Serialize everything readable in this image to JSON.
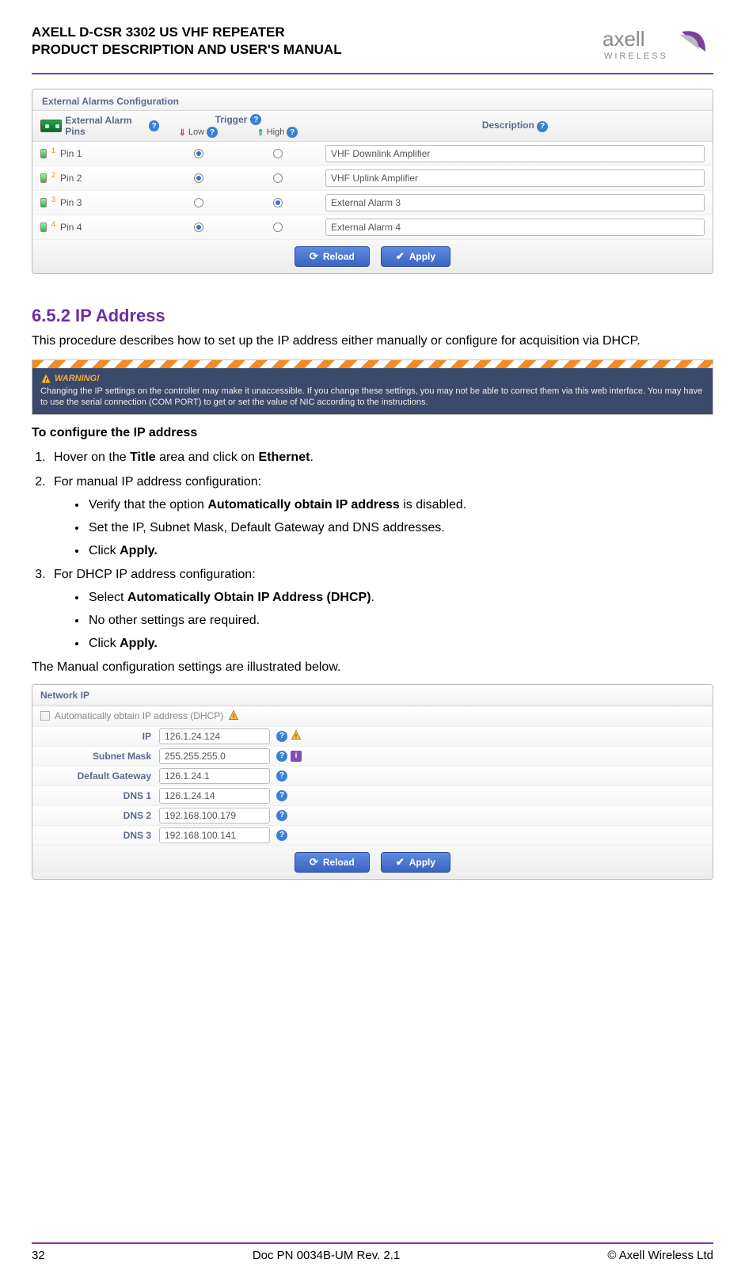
{
  "header": {
    "title_line1": "AXELL D-CSR 3302 US VHF REPEATER",
    "title_line2": "PRODUCT DESCRIPTION AND USER'S MANUAL",
    "logo_text_top": "axell",
    "logo_text_bottom": "WIRELESS"
  },
  "alarms_panel": {
    "title": "External Alarms Configuration",
    "headers": {
      "pins": "External Alarm Pins",
      "trigger": "Trigger",
      "trigger_low": "Low",
      "trigger_high": "High",
      "description": "Description"
    },
    "rows": [
      {
        "sup": "1",
        "pin": "Pin 1",
        "low": true,
        "high": false,
        "desc": "VHF Downlink Amplifier"
      },
      {
        "sup": "2",
        "pin": "Pin 2",
        "low": true,
        "high": false,
        "desc": "VHF Uplink Amplifier"
      },
      {
        "sup": "3",
        "pin": "Pin 3",
        "low": false,
        "high": true,
        "desc": "External Alarm 3"
      },
      {
        "sup": "4",
        "pin": "Pin 4",
        "low": true,
        "high": false,
        "desc": "External Alarm 4"
      }
    ],
    "buttons": {
      "reload": "Reload",
      "apply": "Apply"
    }
  },
  "section": {
    "heading": "6.5.2 IP Address",
    "intro": "This procedure describes how to set up the IP address either manually or configure for acquisition via DHCP.",
    "warning_label": "WARNING!",
    "warning_text": "Changing the IP settings on the controller may make it unaccessible. If you change these settings, you may not be able to correct them via this web interface. You may have to use the serial connection (COM PORT) to get or set the value of NIC according to the instructions.",
    "subhead": "To configure the IP address",
    "step1_pre": "Hover on the ",
    "step1_b1": "Title",
    "step1_mid": " area and click on ",
    "step1_b2": "Ethernet",
    "step1_post": ".",
    "step2": "For manual IP address configuration:",
    "s2b1_pre": "Verify that the option ",
    "s2b1_b": "Automatically obtain IP address",
    "s2b1_post": " is disabled.",
    "s2b2": "Set the IP, Subnet Mask, Default Gateway and DNS addresses.",
    "s2b3_pre": "Click ",
    "s2b3_b": "Apply.",
    "step3": "For DHCP IP address configuration:",
    "s3b1_pre": "Select ",
    "s3b1_b": "Automatically Obtain IP Address (DHCP)",
    "s3b1_post": ".",
    "s3b2": "No other settings are required.",
    "s3b3_pre": "Click ",
    "s3b3_b": "Apply.",
    "closing": "The Manual configuration settings are illustrated below."
  },
  "network_panel": {
    "title": "Network IP",
    "checkbox_label": "Automatically obtain IP address (DHCP)",
    "rows": [
      {
        "label": "IP",
        "value": "126.1.24.124",
        "icons": [
          "help",
          "warn"
        ]
      },
      {
        "label": "Subnet Mask",
        "value": "255.255.255.0",
        "icons": [
          "help",
          "info"
        ]
      },
      {
        "label": "Default Gateway",
        "value": "126.1.24.1",
        "icons": [
          "help"
        ]
      },
      {
        "label": "DNS 1",
        "value": "126.1.24.14",
        "icons": [
          "help"
        ]
      },
      {
        "label": "DNS 2",
        "value": "192.168.100.179",
        "icons": [
          "help"
        ]
      },
      {
        "label": "DNS 3",
        "value": "192.168.100.141",
        "icons": [
          "help"
        ]
      }
    ],
    "buttons": {
      "reload": "Reload",
      "apply": "Apply"
    }
  },
  "footer": {
    "page": "32",
    "doc": "Doc PN 0034B-UM Rev. 2.1",
    "copyright": "© Axell Wireless Ltd"
  }
}
